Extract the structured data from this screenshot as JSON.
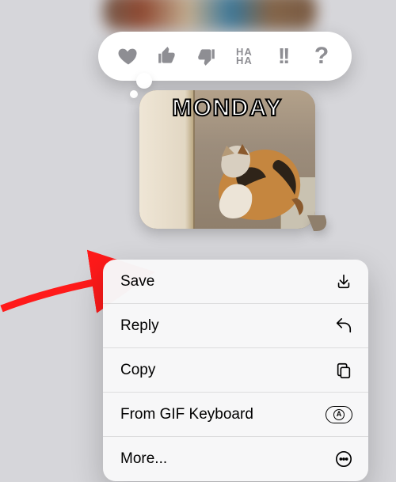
{
  "gif_caption": "MONDAY",
  "tapback": {
    "heart": "heart",
    "thumbs_up": "thumbs-up",
    "thumbs_down": "thumbs-down",
    "haha": "HA HA",
    "emphasize": "!!",
    "question": "?"
  },
  "menu": {
    "save": {
      "label": "Save"
    },
    "reply": {
      "label": "Reply"
    },
    "copy": {
      "label": "Copy"
    },
    "gifkb": {
      "label": "From GIF Keyboard"
    },
    "more": {
      "label": "More..."
    }
  }
}
